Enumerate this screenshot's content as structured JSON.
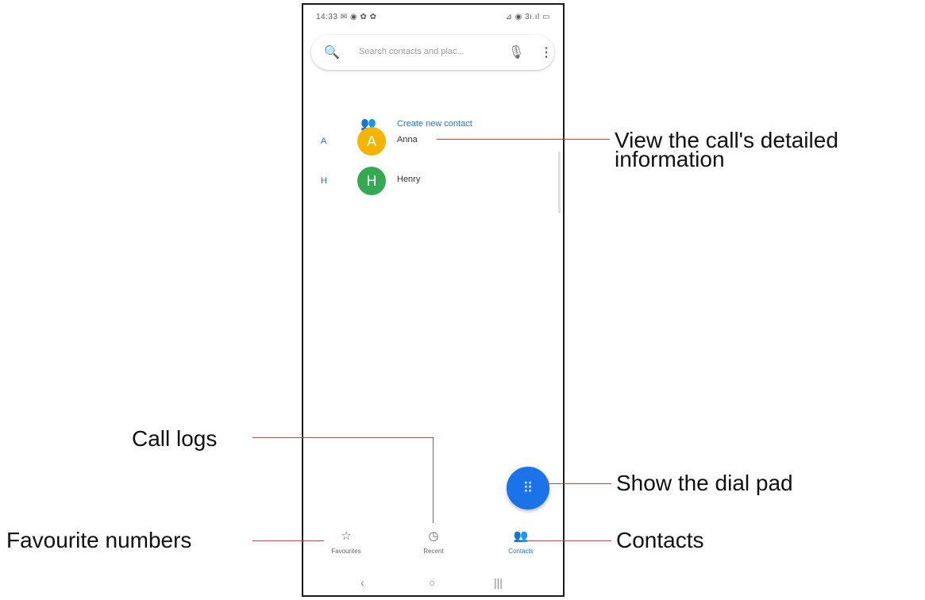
{
  "statusbar": {
    "time_icons": "14:33 ✉ ◉ ✿ ✿",
    "right_icons": "⊿ ◉ 3ı.ıl ▭"
  },
  "search": {
    "placeholder": "Search contacts and plac...",
    "search_icon": "🔍",
    "mic_icon": "🎙",
    "more_icon": "⋮"
  },
  "create_contact": {
    "label": "Create new contact",
    "icon": "👥"
  },
  "contacts": [
    {
      "letter": "A",
      "initial": "A",
      "name": "Anna",
      "color": "#f4b400"
    },
    {
      "letter": "H",
      "initial": "H",
      "name": "Henry",
      "color": "#34a853"
    }
  ],
  "fab": {
    "icon": "⠿"
  },
  "nav": [
    {
      "icon": "☆",
      "label": "Favourites"
    },
    {
      "icon": "◷",
      "label": "Recent"
    },
    {
      "icon": "👥",
      "label": "Contacts"
    }
  ],
  "sysnav": {
    "back": "‹",
    "home": "○",
    "recents": "|||"
  },
  "callouts": {
    "view_details_line1": "View the call's detailed",
    "view_details_line2": "information",
    "call_logs": "Call logs",
    "dial_pad": "Show the dial pad",
    "favourites": "Favourite numbers",
    "contacts": "Contacts"
  },
  "colors": {
    "accent": "#1a73e8",
    "callout_line": "#e53935"
  }
}
